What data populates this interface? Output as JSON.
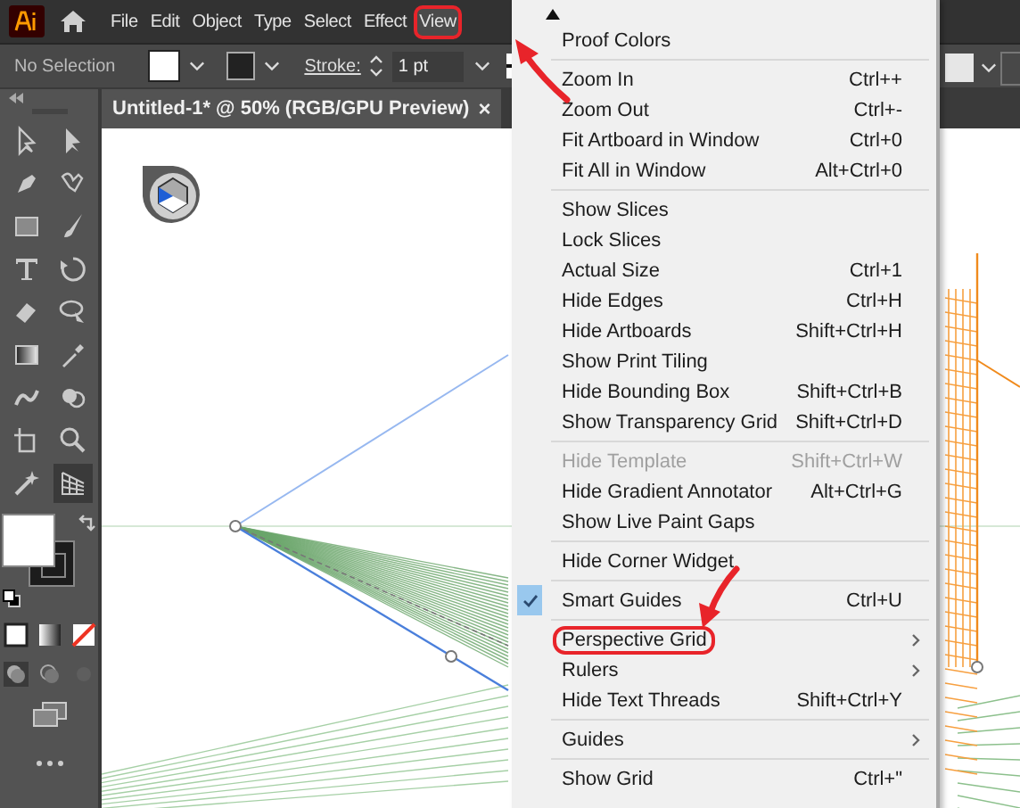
{
  "menubar": {
    "items": [
      {
        "label": "File",
        "selected": false,
        "circled": false
      },
      {
        "label": "Edit",
        "selected": false,
        "circled": false
      },
      {
        "label": "Object",
        "selected": false,
        "circled": false
      },
      {
        "label": "Type",
        "selected": false,
        "circled": false
      },
      {
        "label": "Select",
        "selected": false,
        "circled": false
      },
      {
        "label": "Effect",
        "selected": false,
        "circled": false
      },
      {
        "label": "View",
        "selected": true,
        "circled": true
      }
    ]
  },
  "control_bar": {
    "selection_label": "No Selection",
    "stroke_label": "Stroke:",
    "stroke_weight": "1 pt"
  },
  "document_tab": {
    "title": "Untitled-1* @ 50% (RGB/GPU Preview)",
    "close": "×"
  },
  "toolbar": {
    "tools": [
      {
        "selected": false
      },
      {
        "selected": false
      },
      {
        "selected": false
      },
      {
        "selected": false
      },
      {
        "selected": false
      },
      {
        "selected": false
      },
      {
        "selected": false
      },
      {
        "selected": false
      },
      {
        "selected": false
      },
      {
        "selected": false
      },
      {
        "selected": false
      },
      {
        "selected": false
      },
      {
        "selected": false
      },
      {
        "selected": false
      },
      {
        "selected": false
      },
      {
        "selected": false
      },
      {
        "selected": false
      },
      {
        "selected": true
      }
    ]
  },
  "view_menu": {
    "groups": [
      [
        {
          "label": "Proof Colors",
          "checked": false,
          "disabled": false,
          "submenu": false,
          "circled": false
        }
      ],
      [
        {
          "label": "Zoom In",
          "shortcut": "Ctrl++",
          "checked": false,
          "disabled": false,
          "submenu": false,
          "circled": false
        },
        {
          "label": "Zoom Out",
          "shortcut": "Ctrl+-",
          "checked": false,
          "disabled": false,
          "submenu": false,
          "circled": false
        },
        {
          "label": "Fit Artboard in Window",
          "shortcut": "Ctrl+0",
          "checked": false,
          "disabled": false,
          "submenu": false,
          "circled": false
        },
        {
          "label": "Fit All in Window",
          "shortcut": "Alt+Ctrl+0",
          "checked": false,
          "disabled": false,
          "submenu": false,
          "circled": false
        }
      ],
      [
        {
          "label": "Show Slices",
          "checked": false,
          "disabled": false,
          "submenu": false,
          "circled": false
        },
        {
          "label": "Lock Slices",
          "checked": false,
          "disabled": false,
          "submenu": false,
          "circled": false
        },
        {
          "label": "Actual Size",
          "shortcut": "Ctrl+1",
          "checked": false,
          "disabled": false,
          "submenu": false,
          "circled": false
        },
        {
          "label": "Hide Edges",
          "shortcut": "Ctrl+H",
          "checked": false,
          "disabled": false,
          "submenu": false,
          "circled": false
        },
        {
          "label": "Hide Artboards",
          "shortcut": "Shift+Ctrl+H",
          "checked": false,
          "disabled": false,
          "submenu": false,
          "circled": false
        },
        {
          "label": "Show Print Tiling",
          "checked": false,
          "disabled": false,
          "submenu": false,
          "circled": false
        },
        {
          "label": "Hide Bounding Box",
          "shortcut": "Shift+Ctrl+B",
          "checked": false,
          "disabled": false,
          "submenu": false,
          "circled": false
        },
        {
          "label": "Show Transparency Grid",
          "shortcut": "Shift+Ctrl+D",
          "checked": false,
          "disabled": false,
          "submenu": false,
          "circled": false
        }
      ],
      [
        {
          "label": "Hide Template",
          "shortcut": "Shift+Ctrl+W",
          "checked": false,
          "disabled": true,
          "submenu": false,
          "circled": false
        },
        {
          "label": "Hide Gradient Annotator",
          "shortcut": "Alt+Ctrl+G",
          "checked": false,
          "disabled": false,
          "submenu": false,
          "circled": false
        },
        {
          "label": "Show Live Paint Gaps",
          "checked": false,
          "disabled": false,
          "submenu": false,
          "circled": false
        }
      ],
      [
        {
          "label": "Hide Corner Widget",
          "checked": false,
          "disabled": false,
          "submenu": false,
          "circled": false
        }
      ],
      [
        {
          "label": "Smart Guides",
          "shortcut": "Ctrl+U",
          "checked": true,
          "disabled": false,
          "submenu": false,
          "circled": false
        }
      ],
      [
        {
          "label": "Perspective Grid",
          "checked": false,
          "disabled": false,
          "submenu": true,
          "circled": true
        },
        {
          "label": "Rulers",
          "checked": false,
          "disabled": false,
          "submenu": true,
          "circled": false
        },
        {
          "label": "Hide Text Threads",
          "shortcut": "Shift+Ctrl+Y",
          "checked": false,
          "disabled": false,
          "submenu": false,
          "circled": false
        }
      ],
      [
        {
          "label": "Guides",
          "checked": false,
          "disabled": false,
          "submenu": true,
          "circled": false
        }
      ],
      [
        {
          "label": "Show Grid",
          "shortcut": "Ctrl+\"",
          "checked": false,
          "disabled": false,
          "submenu": false,
          "circled": false
        }
      ]
    ]
  }
}
